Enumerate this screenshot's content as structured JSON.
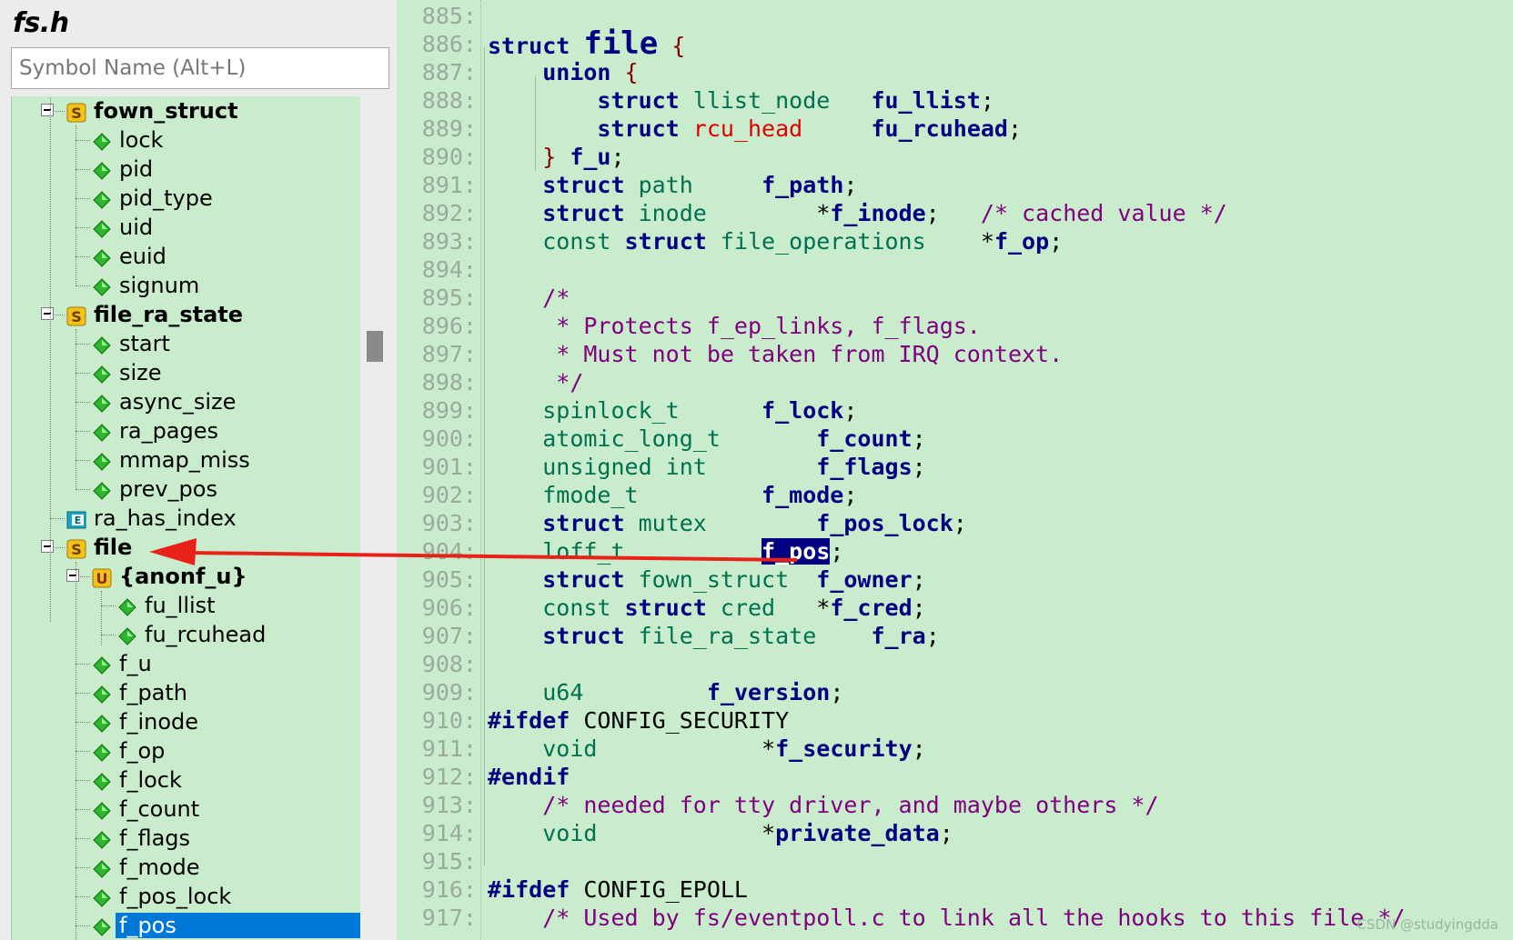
{
  "panel": {
    "title": "fs.h",
    "search_placeholder": "Symbol Name (Alt+L)"
  },
  "tree": {
    "rows": [
      {
        "label": "fown_struct",
        "depth": 1,
        "type": "struct",
        "bold": true,
        "expander": "collapse"
      },
      {
        "label": "lock",
        "depth": 2,
        "type": "member"
      },
      {
        "label": "pid",
        "depth": 2,
        "type": "member"
      },
      {
        "label": "pid_type",
        "depth": 2,
        "type": "member"
      },
      {
        "label": "uid",
        "depth": 2,
        "type": "member"
      },
      {
        "label": "euid",
        "depth": 2,
        "type": "member"
      },
      {
        "label": "signum",
        "depth": 2,
        "type": "member"
      },
      {
        "label": "file_ra_state",
        "depth": 1,
        "type": "struct",
        "bold": true,
        "expander": "collapse"
      },
      {
        "label": "start",
        "depth": 2,
        "type": "member"
      },
      {
        "label": "size",
        "depth": 2,
        "type": "member"
      },
      {
        "label": "async_size",
        "depth": 2,
        "type": "member"
      },
      {
        "label": "ra_pages",
        "depth": 2,
        "type": "member"
      },
      {
        "label": "mmap_miss",
        "depth": 2,
        "type": "member"
      },
      {
        "label": "prev_pos",
        "depth": 2,
        "type": "member"
      },
      {
        "label": "ra_has_index",
        "depth": 1,
        "type": "function"
      },
      {
        "label": "file",
        "depth": 1,
        "type": "struct",
        "bold": true,
        "expander": "collapse"
      },
      {
        "label": "{anonf_u}",
        "depth": 2,
        "type": "union",
        "bold": true,
        "expander": "collapse"
      },
      {
        "label": "fu_llist",
        "depth": 3,
        "type": "member"
      },
      {
        "label": "fu_rcuhead",
        "depth": 3,
        "type": "member"
      },
      {
        "label": "f_u",
        "depth": 2,
        "type": "member"
      },
      {
        "label": "f_path",
        "depth": 2,
        "type": "member"
      },
      {
        "label": "f_inode",
        "depth": 2,
        "type": "member"
      },
      {
        "label": "f_op",
        "depth": 2,
        "type": "member"
      },
      {
        "label": "f_lock",
        "depth": 2,
        "type": "member"
      },
      {
        "label": "f_count",
        "depth": 2,
        "type": "member"
      },
      {
        "label": "f_flags",
        "depth": 2,
        "type": "member"
      },
      {
        "label": "f_mode",
        "depth": 2,
        "type": "member"
      },
      {
        "label": "f_pos_lock",
        "depth": 2,
        "type": "member"
      },
      {
        "label": "f_pos",
        "depth": 2,
        "type": "member",
        "selected": true
      }
    ]
  },
  "editor": {
    "lines": [
      {
        "n": "885:",
        "tokens": []
      },
      {
        "n": "886:",
        "tokens": [
          [
            "k",
            "struct "
          ],
          [
            "m big",
            "file"
          ],
          [
            "p",
            " {"
          ]
        ]
      },
      {
        "n": "887:",
        "tokens": [
          [
            "n",
            "    "
          ],
          [
            "k",
            "union"
          ],
          [
            "p",
            " {"
          ]
        ]
      },
      {
        "n": "888:",
        "tokens": [
          [
            "n",
            "        "
          ],
          [
            "k",
            "struct "
          ],
          [
            "t",
            "llist_node"
          ],
          [
            "n",
            "   "
          ],
          [
            "m",
            "fu_llist"
          ],
          [
            "n",
            ";"
          ]
        ]
      },
      {
        "n": "889:",
        "tokens": [
          [
            "n",
            "        "
          ],
          [
            "k",
            "struct "
          ],
          [
            "tr",
            "rcu_head"
          ],
          [
            "n",
            "     "
          ],
          [
            "m",
            "fu_rcuhead"
          ],
          [
            "n",
            ";"
          ]
        ]
      },
      {
        "n": "890:",
        "tokens": [
          [
            "n",
            "    "
          ],
          [
            "p",
            "} "
          ],
          [
            "m",
            "f_u"
          ],
          [
            "n",
            ";"
          ]
        ]
      },
      {
        "n": "891:",
        "tokens": [
          [
            "n",
            "    "
          ],
          [
            "k",
            "struct "
          ],
          [
            "t",
            "path"
          ],
          [
            "n",
            "     "
          ],
          [
            "m",
            "f_path"
          ],
          [
            "n",
            ";"
          ]
        ]
      },
      {
        "n": "892:",
        "tokens": [
          [
            "n",
            "    "
          ],
          [
            "k",
            "struct "
          ],
          [
            "t",
            "inode"
          ],
          [
            "n",
            "        *"
          ],
          [
            "m",
            "f_inode"
          ],
          [
            "n",
            ";   "
          ],
          [
            "c",
            "/* cached value */"
          ]
        ]
      },
      {
        "n": "893:",
        "tokens": [
          [
            "n",
            "    "
          ],
          [
            "t",
            "const "
          ],
          [
            "k",
            "struct "
          ],
          [
            "t",
            "file_operations"
          ],
          [
            "n",
            "    *"
          ],
          [
            "m",
            "f_op"
          ],
          [
            "n",
            ";"
          ]
        ]
      },
      {
        "n": "894:",
        "tokens": []
      },
      {
        "n": "895:",
        "tokens": [
          [
            "n",
            "    "
          ],
          [
            "c",
            "/*"
          ]
        ]
      },
      {
        "n": "896:",
        "tokens": [
          [
            "n",
            "     "
          ],
          [
            "c",
            "* Protects f_ep_links, f_flags."
          ]
        ]
      },
      {
        "n": "897:",
        "tokens": [
          [
            "n",
            "     "
          ],
          [
            "c",
            "* Must not be taken from IRQ context."
          ]
        ]
      },
      {
        "n": "898:",
        "tokens": [
          [
            "n",
            "     "
          ],
          [
            "c",
            "*/"
          ]
        ]
      },
      {
        "n": "899:",
        "tokens": [
          [
            "n",
            "    "
          ],
          [
            "t",
            "spinlock_t"
          ],
          [
            "n",
            "      "
          ],
          [
            "m",
            "f_lock"
          ],
          [
            "n",
            ";"
          ]
        ]
      },
      {
        "n": "900:",
        "tokens": [
          [
            "n",
            "    "
          ],
          [
            "t",
            "atomic_long_t"
          ],
          [
            "n",
            "       "
          ],
          [
            "m",
            "f_count"
          ],
          [
            "n",
            ";"
          ]
        ]
      },
      {
        "n": "901:",
        "tokens": [
          [
            "n",
            "    "
          ],
          [
            "t",
            "unsigned int"
          ],
          [
            "n",
            "        "
          ],
          [
            "m",
            "f_flags"
          ],
          [
            "n",
            ";"
          ]
        ]
      },
      {
        "n": "902:",
        "tokens": [
          [
            "n",
            "    "
          ],
          [
            "t",
            "fmode_t"
          ],
          [
            "n",
            "         "
          ],
          [
            "m",
            "f_mode"
          ],
          [
            "n",
            ";"
          ]
        ]
      },
      {
        "n": "903:",
        "tokens": [
          [
            "n",
            "    "
          ],
          [
            "k",
            "struct "
          ],
          [
            "t",
            "mutex"
          ],
          [
            "n",
            "        "
          ],
          [
            "m",
            "f_pos_lock"
          ],
          [
            "n",
            ";"
          ]
        ]
      },
      {
        "n": "904:",
        "tokens": [
          [
            "n",
            "    "
          ],
          [
            "t",
            "loff_t"
          ],
          [
            "n",
            "          "
          ],
          [
            "hl",
            "f_pos"
          ],
          [
            "n",
            ";"
          ]
        ]
      },
      {
        "n": "905:",
        "tokens": [
          [
            "n",
            "    "
          ],
          [
            "k",
            "struct "
          ],
          [
            "t",
            "fown_struct"
          ],
          [
            "n",
            "  "
          ],
          [
            "m",
            "f_owner"
          ],
          [
            "n",
            ";"
          ]
        ]
      },
      {
        "n": "906:",
        "tokens": [
          [
            "n",
            "    "
          ],
          [
            "t",
            "const "
          ],
          [
            "k",
            "struct "
          ],
          [
            "t",
            "cred"
          ],
          [
            "n",
            "   *"
          ],
          [
            "m",
            "f_cred"
          ],
          [
            "n",
            ";"
          ]
        ]
      },
      {
        "n": "907:",
        "tokens": [
          [
            "n",
            "    "
          ],
          [
            "k",
            "struct "
          ],
          [
            "t",
            "file_ra_state"
          ],
          [
            "n",
            "    "
          ],
          [
            "m",
            "f_ra"
          ],
          [
            "n",
            ";"
          ]
        ]
      },
      {
        "n": "908:",
        "tokens": []
      },
      {
        "n": "909:",
        "tokens": [
          [
            "n",
            "    "
          ],
          [
            "t",
            "u64"
          ],
          [
            "n",
            "         "
          ],
          [
            "m",
            "f_version"
          ],
          [
            "n",
            ";"
          ]
        ]
      },
      {
        "n": "910:",
        "tokens": [
          [
            "k",
            "#ifdef "
          ],
          [
            "n",
            "CONFIG_SECURITY"
          ]
        ]
      },
      {
        "n": "911:",
        "tokens": [
          [
            "n",
            "    "
          ],
          [
            "t",
            "void"
          ],
          [
            "n",
            "            *"
          ],
          [
            "m",
            "f_security"
          ],
          [
            "n",
            ";"
          ]
        ]
      },
      {
        "n": "912:",
        "tokens": [
          [
            "k",
            "#endif"
          ]
        ]
      },
      {
        "n": "913:",
        "tokens": [
          [
            "n",
            "    "
          ],
          [
            "c",
            "/* needed for tty driver, and maybe others */"
          ]
        ]
      },
      {
        "n": "914:",
        "tokens": [
          [
            "n",
            "    "
          ],
          [
            "t",
            "void"
          ],
          [
            "n",
            "            *"
          ],
          [
            "m",
            "private_data"
          ],
          [
            "n",
            ";"
          ]
        ]
      },
      {
        "n": "915:",
        "tokens": []
      },
      {
        "n": "916:",
        "tokens": [
          [
            "k",
            "#ifdef "
          ],
          [
            "n",
            "CONFIG_EPOLL"
          ]
        ]
      },
      {
        "n": "917:",
        "tokens": [
          [
            "n",
            "    "
          ],
          [
            "c",
            "/* Used by fs/eventpoll.c to link all the hooks to this file */"
          ]
        ]
      }
    ]
  },
  "annotation": {
    "arrow_color": "#e8221b"
  },
  "watermark": "CSDN @studyingdda"
}
